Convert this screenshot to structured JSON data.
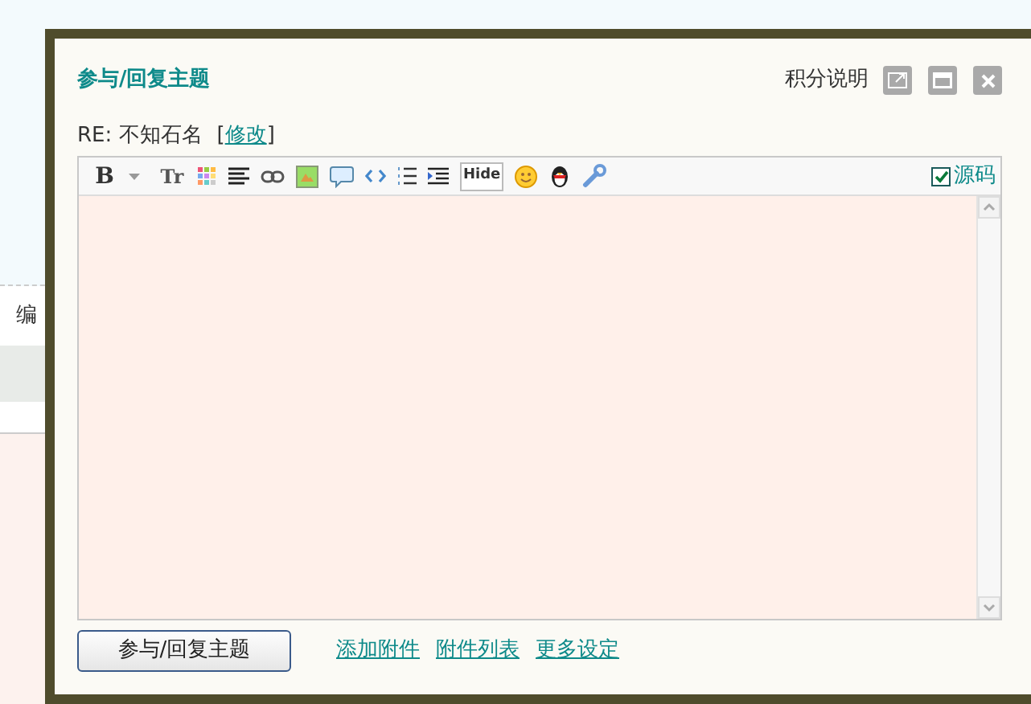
{
  "background_page": {
    "label": "编"
  },
  "dialog": {
    "title": "参与/回复主题",
    "help_link": "积分说明",
    "subject": {
      "text": "RE: 不知石名",
      "edit_link": "修改",
      "bracket_open": "[",
      "bracket_close": "]"
    },
    "toolbar": [
      {
        "kind": "bold",
        "label": "B"
      },
      {
        "kind": "dropdown"
      },
      {
        "kind": "size",
        "label": "Tr"
      },
      {
        "kind": "color"
      },
      {
        "kind": "align"
      },
      {
        "kind": "link"
      },
      {
        "kind": "image"
      },
      {
        "kind": "quote"
      },
      {
        "kind": "code"
      },
      {
        "kind": "ordered"
      },
      {
        "kind": "indent"
      },
      {
        "kind": "hide",
        "label": "Hide"
      },
      {
        "kind": "smiley"
      },
      {
        "kind": "penguin"
      },
      {
        "kind": "wrench"
      }
    ],
    "source_toggle": {
      "label": "源码",
      "checked": true
    },
    "submit_button": "参与/回复主题",
    "links": [
      "添加附件",
      "附件列表",
      "更多设定"
    ]
  }
}
